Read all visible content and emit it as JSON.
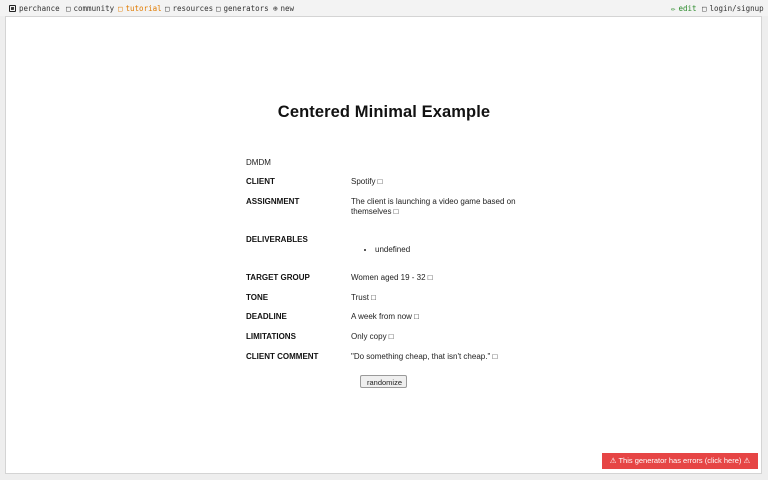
{
  "nav": {
    "brand": "perchance",
    "items": [
      {
        "icon": "□",
        "label": "community"
      },
      {
        "icon": "□",
        "label": "tutorial"
      },
      {
        "icon": "□",
        "label": "resources"
      },
      {
        "icon": "□",
        "label": "generators"
      },
      {
        "icon": "⊕",
        "label": "new"
      }
    ],
    "edit": {
      "icon": "✏",
      "label": "edit"
    },
    "login": {
      "icon": "□",
      "label": "login/signup"
    },
    "active_color": "#e07b00",
    "edit_color": "#2a8a2a"
  },
  "page": {
    "title": "Centered Minimal Example",
    "subtitle": "DMDM",
    "rows": [
      {
        "label": "CLIENT",
        "value": "Spotify □"
      },
      {
        "label": "ASSIGNMENT",
        "value": "The client is launching a video game based on themselves □"
      },
      {
        "label": "DELIVERABLES",
        "list": [
          "undefined"
        ]
      },
      {
        "label": "TARGET GROUP",
        "value": "Women aged 19 - 32 □"
      },
      {
        "label": "TONE",
        "value": "Trust □"
      },
      {
        "label": "DEADLINE",
        "value": "A week from now □"
      },
      {
        "label": "LIMITATIONS",
        "value": "Only copy □"
      },
      {
        "label": "CLIENT COMMENT",
        "value": "\"Do something cheap, that isn't cheap.\" □"
      }
    ],
    "randomize_label": "randomize"
  },
  "error_banner": {
    "text": "⚠ This generator has errors (click here) ⚠",
    "color": "#e64545"
  }
}
